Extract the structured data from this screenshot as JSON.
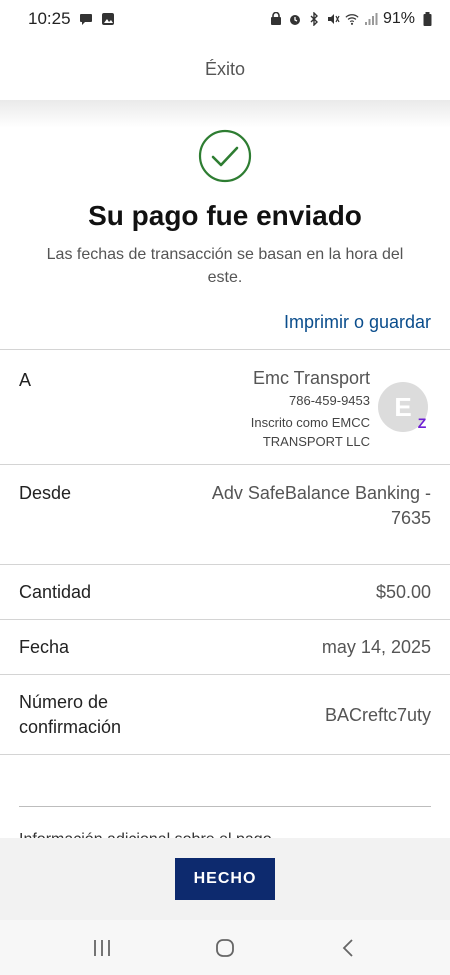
{
  "status_bar": {
    "time": "10:25",
    "battery": "91%"
  },
  "header": {
    "title": "Éxito"
  },
  "success": {
    "title": "Su pago fue enviado",
    "subtitle": "Las fechas de transacción se basan en la hora del este.",
    "print_link": "Imprimir o guardar",
    "accent_color": "#2e7d32"
  },
  "details": {
    "to": {
      "label": "A",
      "name": "Emc Transport",
      "phone": "786-459-9453",
      "registered": "Inscrito como EMCC TRANSPORT LLC",
      "avatar_letter": "E",
      "badge": "Z"
    },
    "from": {
      "label": "Desde",
      "value": "Adv SafeBalance Banking - 7635"
    },
    "amount": {
      "label": "Cantidad",
      "value": "$50.00"
    },
    "date": {
      "label": "Fecha",
      "value": "may 14, 2025"
    },
    "confirmation": {
      "label": "Número de confirmación",
      "value": "BACreftc7uty"
    }
  },
  "footer": {
    "done_label": "HECHO",
    "truncated_text": "Información adicional sobre el pago"
  },
  "colors": {
    "link": "#0a4d8c",
    "button": "#0d2a6e",
    "zelle": "#6d1ed4"
  }
}
